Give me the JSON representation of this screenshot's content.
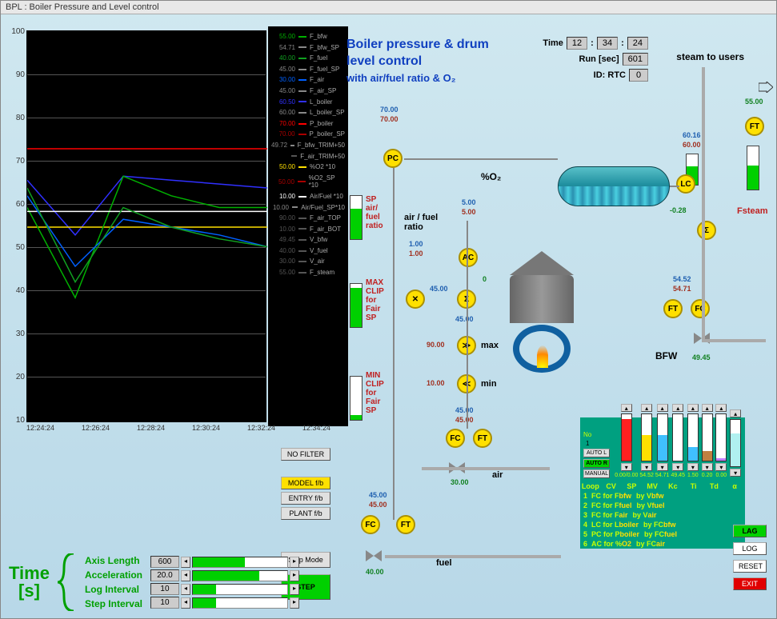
{
  "window_title": "BPL : Boiler Pressure and Level control",
  "title": {
    "line1": "Boiler pressure & drum",
    "line2": "level control",
    "line3": "with air/fuel ratio & O₂"
  },
  "status": {
    "time_label": "Time",
    "time_h": "12",
    "time_m": "34",
    "time_s": "24",
    "run_label": "Run [sec]",
    "run_val": "601",
    "id_label": "ID:  RTC",
    "id_val": "0"
  },
  "steam_label": "steam to users",
  "legend": [
    {
      "val": "55.00",
      "name": "F_bfw",
      "color": "#00b000"
    },
    {
      "val": "54.71",
      "name": "F_bfw_SP",
      "color": "#888"
    },
    {
      "val": "40.00",
      "name": "F_fuel",
      "color": "#10a020"
    },
    {
      "val": "45.00",
      "name": "F_fuel_SP",
      "color": "#888"
    },
    {
      "val": "30.00",
      "name": "F_air",
      "color": "#0060ff"
    },
    {
      "val": "45.00",
      "name": "F_air_SP",
      "color": "#888"
    },
    {
      "val": "60.50",
      "name": "L_boiler",
      "color": "#3030ff"
    },
    {
      "val": "60.00",
      "name": "L_boiler_SP",
      "color": "#888"
    },
    {
      "val": "70.00",
      "name": "P_boiler",
      "color": "#ff0000"
    },
    {
      "val": "70.00",
      "name": "P_boiler_SP",
      "color": "#aa0000"
    },
    {
      "val": "49.72",
      "name": "F_bfw_TRIM+50",
      "color": "#888"
    },
    {
      "val": "",
      "name": "F_air_TRIM+50",
      "color": "#555"
    },
    {
      "val": "50.00",
      "name": "%O2 *10",
      "color": "#ffe000"
    },
    {
      "val": "50.00",
      "name": "%O2_SP *10",
      "color": "#aa0000"
    },
    {
      "val": "10.00",
      "name": "Air/Fuel *10",
      "color": "#fff"
    },
    {
      "val": "10.00",
      "name": "Air/Fuel_SP*10",
      "color": "#888"
    },
    {
      "val": "90.00",
      "name": "F_air_TOP",
      "color": "#555"
    },
    {
      "val": "10.00",
      "name": "F_air_BOT",
      "color": "#555"
    },
    {
      "val": "49.45",
      "name": "V_bfw",
      "color": "#555"
    },
    {
      "val": "40.00",
      "name": "V_fuel",
      "color": "#555"
    },
    {
      "val": "30.00",
      "name": "V_air",
      "color": "#555"
    },
    {
      "val": "55.00",
      "name": "F_steam",
      "color": "#555"
    }
  ],
  "chart_data": {
    "type": "line",
    "ylim": [
      0,
      100
    ],
    "x_ticks": [
      "12:24:24",
      "12:26:24",
      "12:28:24",
      "12:30:24",
      "12:32:24",
      "12:34:24"
    ],
    "series": [
      {
        "name": "P_boiler",
        "color": "#ff0000",
        "values": [
          70,
          70,
          70,
          70,
          70,
          70
        ]
      },
      {
        "name": "L_boiler",
        "color": "#3030ff",
        "values": [
          62,
          48,
          63,
          62,
          61,
          60
        ]
      },
      {
        "name": "%O2*10",
        "color": "#ffe000",
        "values": [
          50,
          50,
          50,
          50,
          50,
          50
        ]
      },
      {
        "name": "F_bfw",
        "color": "#00b000",
        "values": [
          55,
          32,
          63,
          58,
          55,
          55
        ]
      },
      {
        "name": "Air/Fuel*10",
        "color": "#ffffff",
        "values": [
          54,
          54,
          54,
          54,
          54,
          54
        ]
      },
      {
        "name": "F_air",
        "color": "#0060ff",
        "values": [
          58,
          40,
          52,
          50,
          48,
          45
        ]
      },
      {
        "name": "F_fuel",
        "color": "#10a020",
        "values": [
          60,
          36,
          55,
          50,
          47,
          45
        ]
      }
    ]
  },
  "yaxis": [
    "100",
    "90",
    "80",
    "70",
    "60",
    "50",
    "40",
    "30",
    "20",
    "10"
  ],
  "annotations": {
    "sp_ratio": "SP\nair/\nfuel\nratio",
    "max_clip": "MAX\nCLIP\nfor\nFair\nSP",
    "min_clip": "MIN\nCLIP\nfor\nFair\nSP"
  },
  "process": {
    "pc_sp": "70.00",
    "pc_pv": "70.00",
    "o2_label": "%O₂",
    "o2_sp": "5.00",
    "o2_pv": "5.00",
    "af_label": "air / fuel\nratio",
    "af_sp": "1.00",
    "af_pv": "1.00",
    "af_out": "0",
    "mult_in": "45.00",
    "sum_out": "45.00",
    "max_lbl": "max",
    "max_val": "90.00",
    "min_lbl": "min",
    "min_val": "10.00",
    "fc_air_sp": "45.00",
    "fc_air_pv": "45.00",
    "air_lbl": "air",
    "v_air": "30.00",
    "fc_fuel_sp": "45.00",
    "fc_fuel_pv": "45.00",
    "fuel_lbl": "fuel",
    "v_fuel": "40.00",
    "lc_sp": "60.16",
    "lc_pv": "60.00",
    "lc_out": "-0.28",
    "ft_steam": "55.00",
    "fsteam_lbl": "Fsteam",
    "fc_bfw_sp": "54.52",
    "fc_bfw_pv": "54.71",
    "bfw_lbl": "BFW",
    "v_bfw": "49.45"
  },
  "buttons": {
    "no_filter": "NO FILTER",
    "model": "MODEL f/b",
    "entry": "ENTRY f/b",
    "plant": "PLANT f/b",
    "step_mode": "Step Mode",
    "step": "STEP",
    "lag": "LAG",
    "log": "LOG",
    "reset": "RESET",
    "exit": "EXIT"
  },
  "time_settings": {
    "head": "Time\n[s]",
    "rows": [
      {
        "label": "Axis Length",
        "val": "600",
        "pct": 55
      },
      {
        "label": "Acceleration",
        "val": "20.0",
        "pct": 70
      },
      {
        "label": "Log Interval",
        "val": "10",
        "pct": 25
      },
      {
        "label": "Step Interval",
        "val": "10",
        "pct": 25
      }
    ]
  },
  "loop": {
    "mode_btns": [
      "AUTO L",
      "AUTO R",
      "MANUAL"
    ],
    "no_label": "No",
    "no_val": "1",
    "col_vals": [
      "0.00/0.00",
      "54.52",
      "54.71",
      "49.45",
      "1.50",
      "0.20",
      "0.00",
      ""
    ],
    "header": [
      "Loop",
      "CV",
      "SP",
      "MV",
      "Kc",
      "Ti",
      "Td",
      "α"
    ],
    "bar_colors": [
      "#ff2020",
      "#ffe000",
      "#40c0ff",
      "#ffffff",
      "#40c0ff",
      "#c08040",
      "#c080ff",
      "#b0f0f0"
    ],
    "rows": [
      {
        "i": "1",
        "t1": "FC for F",
        "v1": "bfw",
        "t2": "by V",
        "v2": "bfw"
      },
      {
        "i": "2",
        "t1": "FC for F",
        "v1": "fuel",
        "t2": "by V",
        "v2": "fuel"
      },
      {
        "i": "3",
        "t1": "FC for F",
        "v1": "air",
        "t2": "by V",
        "v2": "air"
      },
      {
        "i": "4",
        "t1": "LC for L",
        "v1": "boiler",
        "t2": "by FC",
        "v2": "bfw"
      },
      {
        "i": "5",
        "t1": "PC for P",
        "v1": "boiler",
        "t2": "by FC",
        "v2": "fuel"
      },
      {
        "i": "6",
        "t1": "AC for %",
        "v1": "O2",
        "t2": "by FC",
        "v2": "air"
      }
    ]
  }
}
